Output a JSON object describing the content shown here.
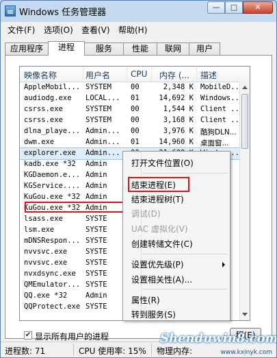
{
  "window": {
    "title": "Windows 任务管理器",
    "min": "—",
    "max": "□",
    "close": "✕"
  },
  "menu": [
    "文件(F)",
    "选项(O)",
    "查看(V)",
    "帮助(H)"
  ],
  "tabs": [
    "应用程序",
    "进程",
    "服务",
    "性能",
    "联网",
    "用户"
  ],
  "active_tab": "进程",
  "table": {
    "headers": [
      "映像名称",
      "用户名",
      "CPU",
      "内存 (...",
      "描述"
    ],
    "rows": [
      [
        "AppleMobil...",
        "SYSTEM",
        "00",
        "2,348 K",
        "MobileD..."
      ],
      [
        "audiodg.exe",
        "LOCAL...",
        "01",
        "14,692 K",
        "Windows..."
      ],
      [
        "csrss.exe",
        "SYSTEM",
        "00",
        "1,544 K",
        "Client ..."
      ],
      [
        "csrss.exe",
        "SYSTEM",
        "00",
        "3,168 K",
        "Client ..."
      ],
      [
        "dlna_playe...",
        "Admin...",
        "00",
        "3,976 K",
        "酷狗DLN..."
      ],
      [
        "dwm.exe",
        "Admin...",
        "01",
        "14,960 K",
        "桌面窗..."
      ],
      [
        "explorer.exe",
        "Admin...",
        "00",
        "21,600 K",
        "Windows..."
      ],
      [
        "kadb.exe *32",
        "Admin",
        "",
        "",
        ""
      ],
      [
        "KGDaemon.e...",
        "Admin",
        "",
        "",
        ""
      ],
      [
        "KGService....",
        "Admin",
        "",
        "",
        ""
      ],
      [
        "KuGou.exe *32",
        "Admin",
        "",
        "",
        ""
      ],
      [
        "KuGou.exe *32",
        "Admin",
        "",
        "",
        ""
      ],
      [
        "lsass.exe",
        "SYSTE",
        "",
        "",
        ""
      ],
      [
        "lsm.exe",
        "SYSTE",
        "",
        "",
        ""
      ],
      [
        "mDNSRespon...",
        "SYSTE",
        "",
        "",
        ""
      ],
      [
        "nvvsvc.exe",
        "SYSTE",
        "",
        "",
        ""
      ],
      [
        "nvvsvc.exe",
        "SYSTE",
        "",
        "",
        ""
      ],
      [
        "nvxdsync.exe",
        "SYSTE",
        "",
        "",
        ""
      ],
      [
        "QMEmulator...",
        "SYSTE",
        "",
        "",
        ""
      ],
      [
        "QQ.exe *32",
        "Admin",
        "",
        "",
        ""
      ],
      [
        "QQProtect.exe",
        "SYSTE",
        "",
        "",
        ""
      ]
    ],
    "selected_row": 6
  },
  "show_all": {
    "label": "显示所有用户的进程",
    "checked": "✔"
  },
  "end_button": "程(E)",
  "context_menu": {
    "items": [
      {
        "label": "打开文件位置(O)",
        "disabled": false
      },
      {
        "label": "结束进程(E)",
        "disabled": false
      },
      {
        "label": "结束进程树(T)",
        "disabled": false
      },
      {
        "label": "调试(D)",
        "disabled": true
      },
      {
        "label": "UAC 虚拟化(V)",
        "disabled": true
      },
      {
        "label": "创建转储文件(C)",
        "disabled": false
      },
      {
        "label": "设置优先级(P)",
        "disabled": false,
        "submenu": true
      },
      {
        "label": "设置相关性(A)...",
        "disabled": false
      },
      {
        "label": "属性(R)",
        "disabled": false
      },
      {
        "label": "转到服务(S)",
        "disabled": false
      }
    ]
  },
  "status": {
    "processes": "进程数: 71",
    "cpu": "CPU 使用率: 15%",
    "mem": "物理内存:"
  },
  "watermark": {
    "text": "Shenduwin8.com",
    "url": "www.kxinyk.com"
  }
}
